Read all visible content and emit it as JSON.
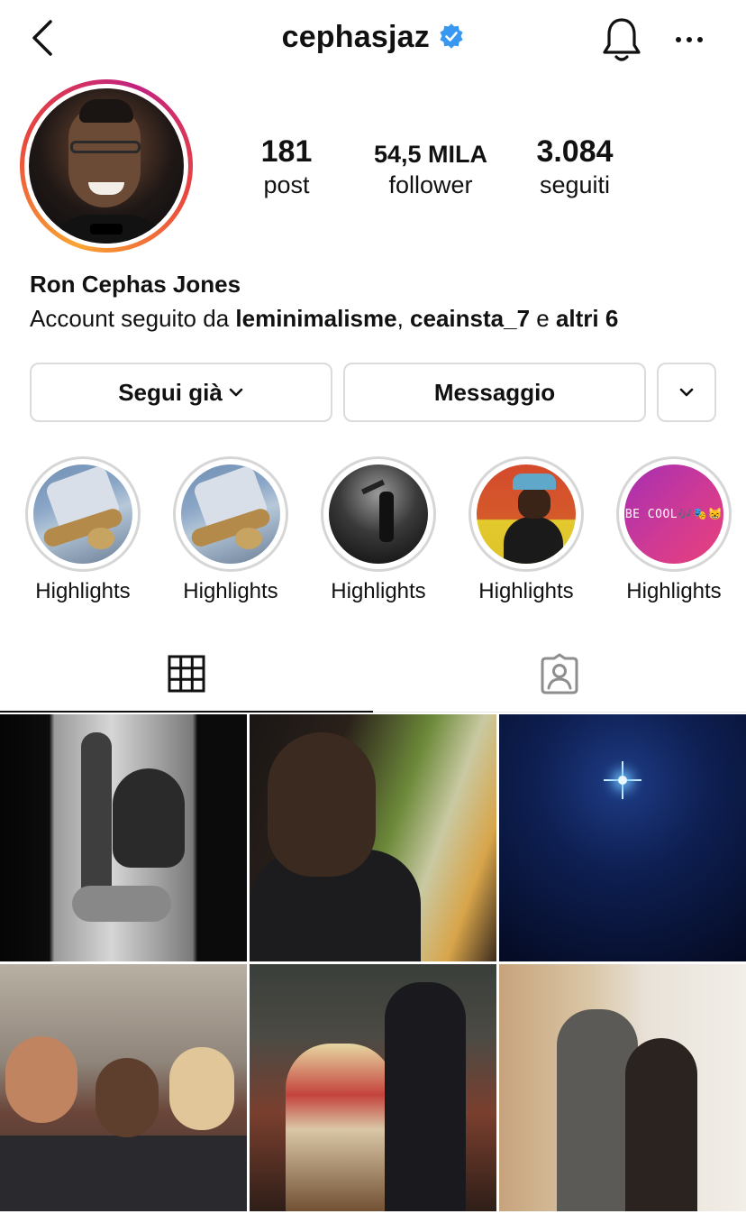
{
  "header": {
    "username": "cephasjaz",
    "icons": {
      "back": "chevron-left-icon",
      "verified": "verified-badge-icon",
      "bell": "bell-icon",
      "more": "more-horizontal-icon"
    },
    "verified_color": "#3897f0"
  },
  "profile": {
    "full_name": "Ron Cephas Jones",
    "followed_by_prefix": "Account seguito da ",
    "followed_by_user1": "leminimalisme",
    "followed_by_sep": ", ",
    "followed_by_user2": "ceainsta_7",
    "followed_by_and": " e ",
    "followed_by_others": "altri 6"
  },
  "stats": [
    {
      "value": "181",
      "label": "post"
    },
    {
      "value": "54,5 MILA",
      "label": "follower"
    },
    {
      "value": "3.084",
      "label": "seguiti"
    }
  ],
  "actions": {
    "following_label": "Segui già",
    "message_label": "Messaggio",
    "suggest_icon": "chevron-down-icon"
  },
  "highlights": [
    {
      "label": "Highlights"
    },
    {
      "label": "Highlights"
    },
    {
      "label": "Highlights"
    },
    {
      "label": "Highlights"
    },
    {
      "label": "Highlights",
      "cover_text": "BE COOL🎶🎭😸"
    }
  ],
  "tabs": [
    {
      "icon": "grid-icon",
      "selected": true
    },
    {
      "icon": "tagged-person-icon",
      "selected": false
    }
  ],
  "posts": [
    {
      "name": "post-trophy"
    },
    {
      "name": "post-portrait-green"
    },
    {
      "name": "post-star-night"
    },
    {
      "name": "post-couch-selfie"
    },
    {
      "name": "post-jukebox"
    },
    {
      "name": "post-kitchen-hug"
    }
  ]
}
